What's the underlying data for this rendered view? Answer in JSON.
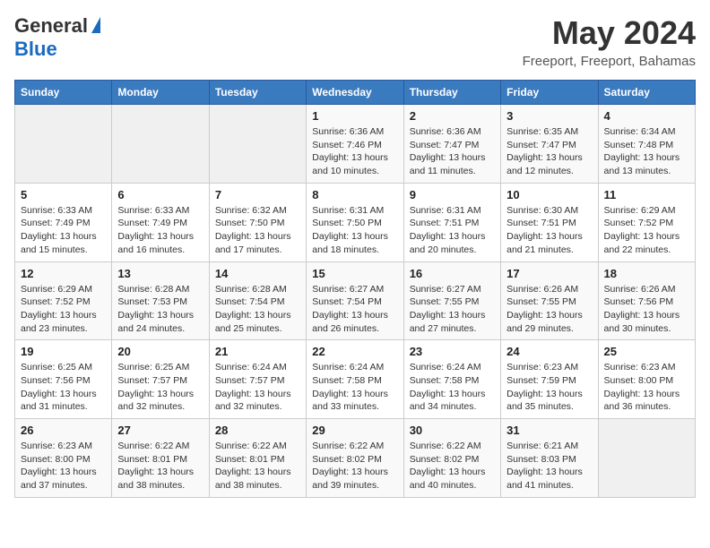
{
  "header": {
    "logo_general": "General",
    "logo_blue": "Blue",
    "month_year": "May 2024",
    "location": "Freeport, Freeport, Bahamas"
  },
  "days_of_week": [
    "Sunday",
    "Monday",
    "Tuesday",
    "Wednesday",
    "Thursday",
    "Friday",
    "Saturday"
  ],
  "weeks": [
    [
      {
        "day": "",
        "sunrise": "",
        "sunset": "",
        "daylight": ""
      },
      {
        "day": "",
        "sunrise": "",
        "sunset": "",
        "daylight": ""
      },
      {
        "day": "",
        "sunrise": "",
        "sunset": "",
        "daylight": ""
      },
      {
        "day": "1",
        "sunrise": "Sunrise: 6:36 AM",
        "sunset": "Sunset: 7:46 PM",
        "daylight": "Daylight: 13 hours and 10 minutes."
      },
      {
        "day": "2",
        "sunrise": "Sunrise: 6:36 AM",
        "sunset": "Sunset: 7:47 PM",
        "daylight": "Daylight: 13 hours and 11 minutes."
      },
      {
        "day": "3",
        "sunrise": "Sunrise: 6:35 AM",
        "sunset": "Sunset: 7:47 PM",
        "daylight": "Daylight: 13 hours and 12 minutes."
      },
      {
        "day": "4",
        "sunrise": "Sunrise: 6:34 AM",
        "sunset": "Sunset: 7:48 PM",
        "daylight": "Daylight: 13 hours and 13 minutes."
      }
    ],
    [
      {
        "day": "5",
        "sunrise": "Sunrise: 6:33 AM",
        "sunset": "Sunset: 7:49 PM",
        "daylight": "Daylight: 13 hours and 15 minutes."
      },
      {
        "day": "6",
        "sunrise": "Sunrise: 6:33 AM",
        "sunset": "Sunset: 7:49 PM",
        "daylight": "Daylight: 13 hours and 16 minutes."
      },
      {
        "day": "7",
        "sunrise": "Sunrise: 6:32 AM",
        "sunset": "Sunset: 7:50 PM",
        "daylight": "Daylight: 13 hours and 17 minutes."
      },
      {
        "day": "8",
        "sunrise": "Sunrise: 6:31 AM",
        "sunset": "Sunset: 7:50 PM",
        "daylight": "Daylight: 13 hours and 18 minutes."
      },
      {
        "day": "9",
        "sunrise": "Sunrise: 6:31 AM",
        "sunset": "Sunset: 7:51 PM",
        "daylight": "Daylight: 13 hours and 20 minutes."
      },
      {
        "day": "10",
        "sunrise": "Sunrise: 6:30 AM",
        "sunset": "Sunset: 7:51 PM",
        "daylight": "Daylight: 13 hours and 21 minutes."
      },
      {
        "day": "11",
        "sunrise": "Sunrise: 6:29 AM",
        "sunset": "Sunset: 7:52 PM",
        "daylight": "Daylight: 13 hours and 22 minutes."
      }
    ],
    [
      {
        "day": "12",
        "sunrise": "Sunrise: 6:29 AM",
        "sunset": "Sunset: 7:52 PM",
        "daylight": "Daylight: 13 hours and 23 minutes."
      },
      {
        "day": "13",
        "sunrise": "Sunrise: 6:28 AM",
        "sunset": "Sunset: 7:53 PM",
        "daylight": "Daylight: 13 hours and 24 minutes."
      },
      {
        "day": "14",
        "sunrise": "Sunrise: 6:28 AM",
        "sunset": "Sunset: 7:54 PM",
        "daylight": "Daylight: 13 hours and 25 minutes."
      },
      {
        "day": "15",
        "sunrise": "Sunrise: 6:27 AM",
        "sunset": "Sunset: 7:54 PM",
        "daylight": "Daylight: 13 hours and 26 minutes."
      },
      {
        "day": "16",
        "sunrise": "Sunrise: 6:27 AM",
        "sunset": "Sunset: 7:55 PM",
        "daylight": "Daylight: 13 hours and 27 minutes."
      },
      {
        "day": "17",
        "sunrise": "Sunrise: 6:26 AM",
        "sunset": "Sunset: 7:55 PM",
        "daylight": "Daylight: 13 hours and 29 minutes."
      },
      {
        "day": "18",
        "sunrise": "Sunrise: 6:26 AM",
        "sunset": "Sunset: 7:56 PM",
        "daylight": "Daylight: 13 hours and 30 minutes."
      }
    ],
    [
      {
        "day": "19",
        "sunrise": "Sunrise: 6:25 AM",
        "sunset": "Sunset: 7:56 PM",
        "daylight": "Daylight: 13 hours and 31 minutes."
      },
      {
        "day": "20",
        "sunrise": "Sunrise: 6:25 AM",
        "sunset": "Sunset: 7:57 PM",
        "daylight": "Daylight: 13 hours and 32 minutes."
      },
      {
        "day": "21",
        "sunrise": "Sunrise: 6:24 AM",
        "sunset": "Sunset: 7:57 PM",
        "daylight": "Daylight: 13 hours and 32 minutes."
      },
      {
        "day": "22",
        "sunrise": "Sunrise: 6:24 AM",
        "sunset": "Sunset: 7:58 PM",
        "daylight": "Daylight: 13 hours and 33 minutes."
      },
      {
        "day": "23",
        "sunrise": "Sunrise: 6:24 AM",
        "sunset": "Sunset: 7:58 PM",
        "daylight": "Daylight: 13 hours and 34 minutes."
      },
      {
        "day": "24",
        "sunrise": "Sunrise: 6:23 AM",
        "sunset": "Sunset: 7:59 PM",
        "daylight": "Daylight: 13 hours and 35 minutes."
      },
      {
        "day": "25",
        "sunrise": "Sunrise: 6:23 AM",
        "sunset": "Sunset: 8:00 PM",
        "daylight": "Daylight: 13 hours and 36 minutes."
      }
    ],
    [
      {
        "day": "26",
        "sunrise": "Sunrise: 6:23 AM",
        "sunset": "Sunset: 8:00 PM",
        "daylight": "Daylight: 13 hours and 37 minutes."
      },
      {
        "day": "27",
        "sunrise": "Sunrise: 6:22 AM",
        "sunset": "Sunset: 8:01 PM",
        "daylight": "Daylight: 13 hours and 38 minutes."
      },
      {
        "day": "28",
        "sunrise": "Sunrise: 6:22 AM",
        "sunset": "Sunset: 8:01 PM",
        "daylight": "Daylight: 13 hours and 38 minutes."
      },
      {
        "day": "29",
        "sunrise": "Sunrise: 6:22 AM",
        "sunset": "Sunset: 8:02 PM",
        "daylight": "Daylight: 13 hours and 39 minutes."
      },
      {
        "day": "30",
        "sunrise": "Sunrise: 6:22 AM",
        "sunset": "Sunset: 8:02 PM",
        "daylight": "Daylight: 13 hours and 40 minutes."
      },
      {
        "day": "31",
        "sunrise": "Sunrise: 6:21 AM",
        "sunset": "Sunset: 8:03 PM",
        "daylight": "Daylight: 13 hours and 41 minutes."
      },
      {
        "day": "",
        "sunrise": "",
        "sunset": "",
        "daylight": ""
      }
    ]
  ]
}
